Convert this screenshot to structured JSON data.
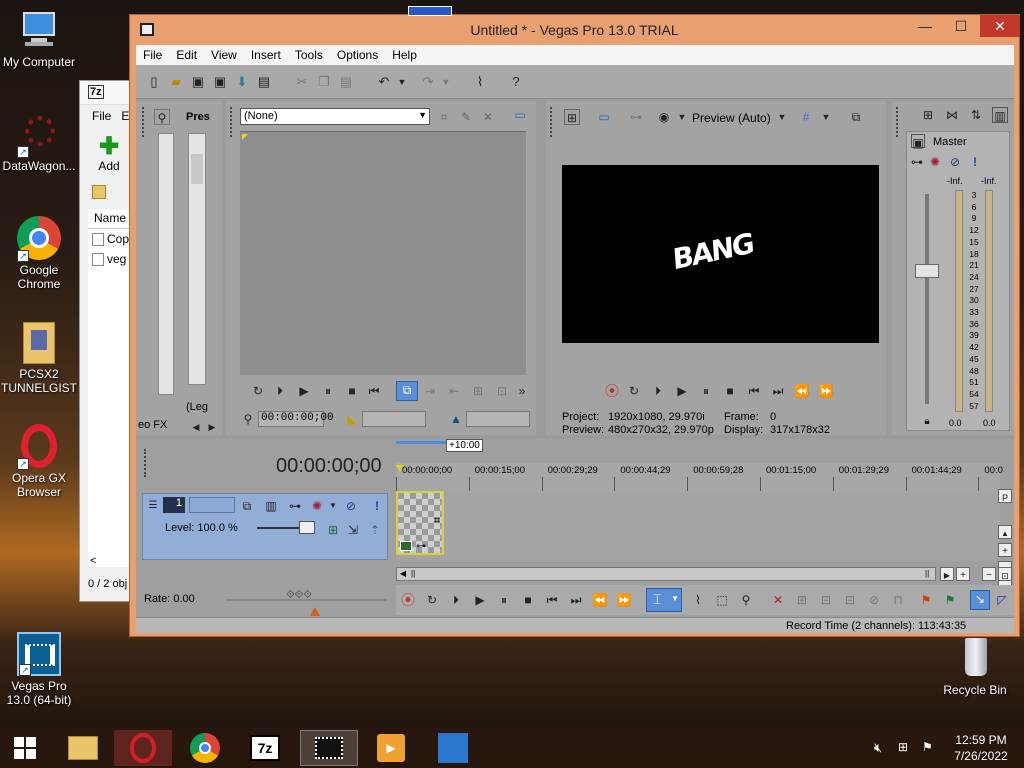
{
  "desktop": {
    "icons": [
      {
        "label": "My Computer"
      },
      {
        "label": "DataWagon..."
      },
      {
        "label": "Google Chrome"
      },
      {
        "label": "PCSX2 TUNNELGIST"
      },
      {
        "label": "Opera GX Browser"
      },
      {
        "label": "Vegas Pro 13.0 (64-bit)"
      },
      {
        "label": "Recycle Bin"
      }
    ]
  },
  "sevenzip": {
    "title": "7z",
    "menu_file": "File",
    "menu_edit": "E",
    "add_label": "Add",
    "col_name": "Name",
    "rows": [
      "Cop",
      "veg"
    ],
    "status": "0 / 2 obj"
  },
  "vegas": {
    "title": "Untitled * - Vegas Pro 13.0 TRIAL",
    "menu": [
      "File",
      "Edit",
      "View",
      "Insert",
      "Tools",
      "Options",
      "Help"
    ],
    "explorer_tab": "Pres",
    "media_fx_tab": "eo FX",
    "legend_tab": "(Leg",
    "trimmer": {
      "dropdown": "(None)",
      "timecode": "00:00:00;00"
    },
    "preview": {
      "quality": "Preview (Auto)",
      "project_label": "Project:",
      "project_value": "1920x1080, 29.970i",
      "frame_label": "Frame:",
      "frame_value": "0",
      "preview_label": "Preview:",
      "preview_value": "480x270x32, 29.970p",
      "display_label": "Display:",
      "display_value": "317x178x32",
      "overlay_text": "BANG"
    },
    "mixer": {
      "label": "Master",
      "inf_left": "-Inf.",
      "inf_right": "-Inf.",
      "scale": [
        "3",
        "6",
        "9",
        "12",
        "15",
        "18",
        "21",
        "24",
        "27",
        "30",
        "33",
        "36",
        "39",
        "42",
        "45",
        "48",
        "51",
        "54",
        "57"
      ],
      "bottom_left": "0.0",
      "bottom_right": "0.0"
    },
    "timeline": {
      "big_timecode": "00:00:00;00",
      "zoom_label": "+10:00",
      "ruler": [
        "00:00:00;00",
        "00:00:15;00",
        "00:00:29;29",
        "00:00:44;29",
        "00:00:59;28",
        "00:01:15;00",
        "00:01:29;29",
        "00:01:44;29",
        "00:0"
      ],
      "track_number": "1",
      "level_label": "Level: 100.0 %",
      "rate_label": "Rate: 0.00",
      "record_time": "Record Time (2 channels): 113:43:35"
    }
  },
  "taskbar": {
    "time": "12:59 PM",
    "date": "7/26/2022"
  },
  "colors": {
    "vegas_frame": "#e8a070",
    "track_header": "#93aed6",
    "accent_blue": "#4a8fd8"
  }
}
